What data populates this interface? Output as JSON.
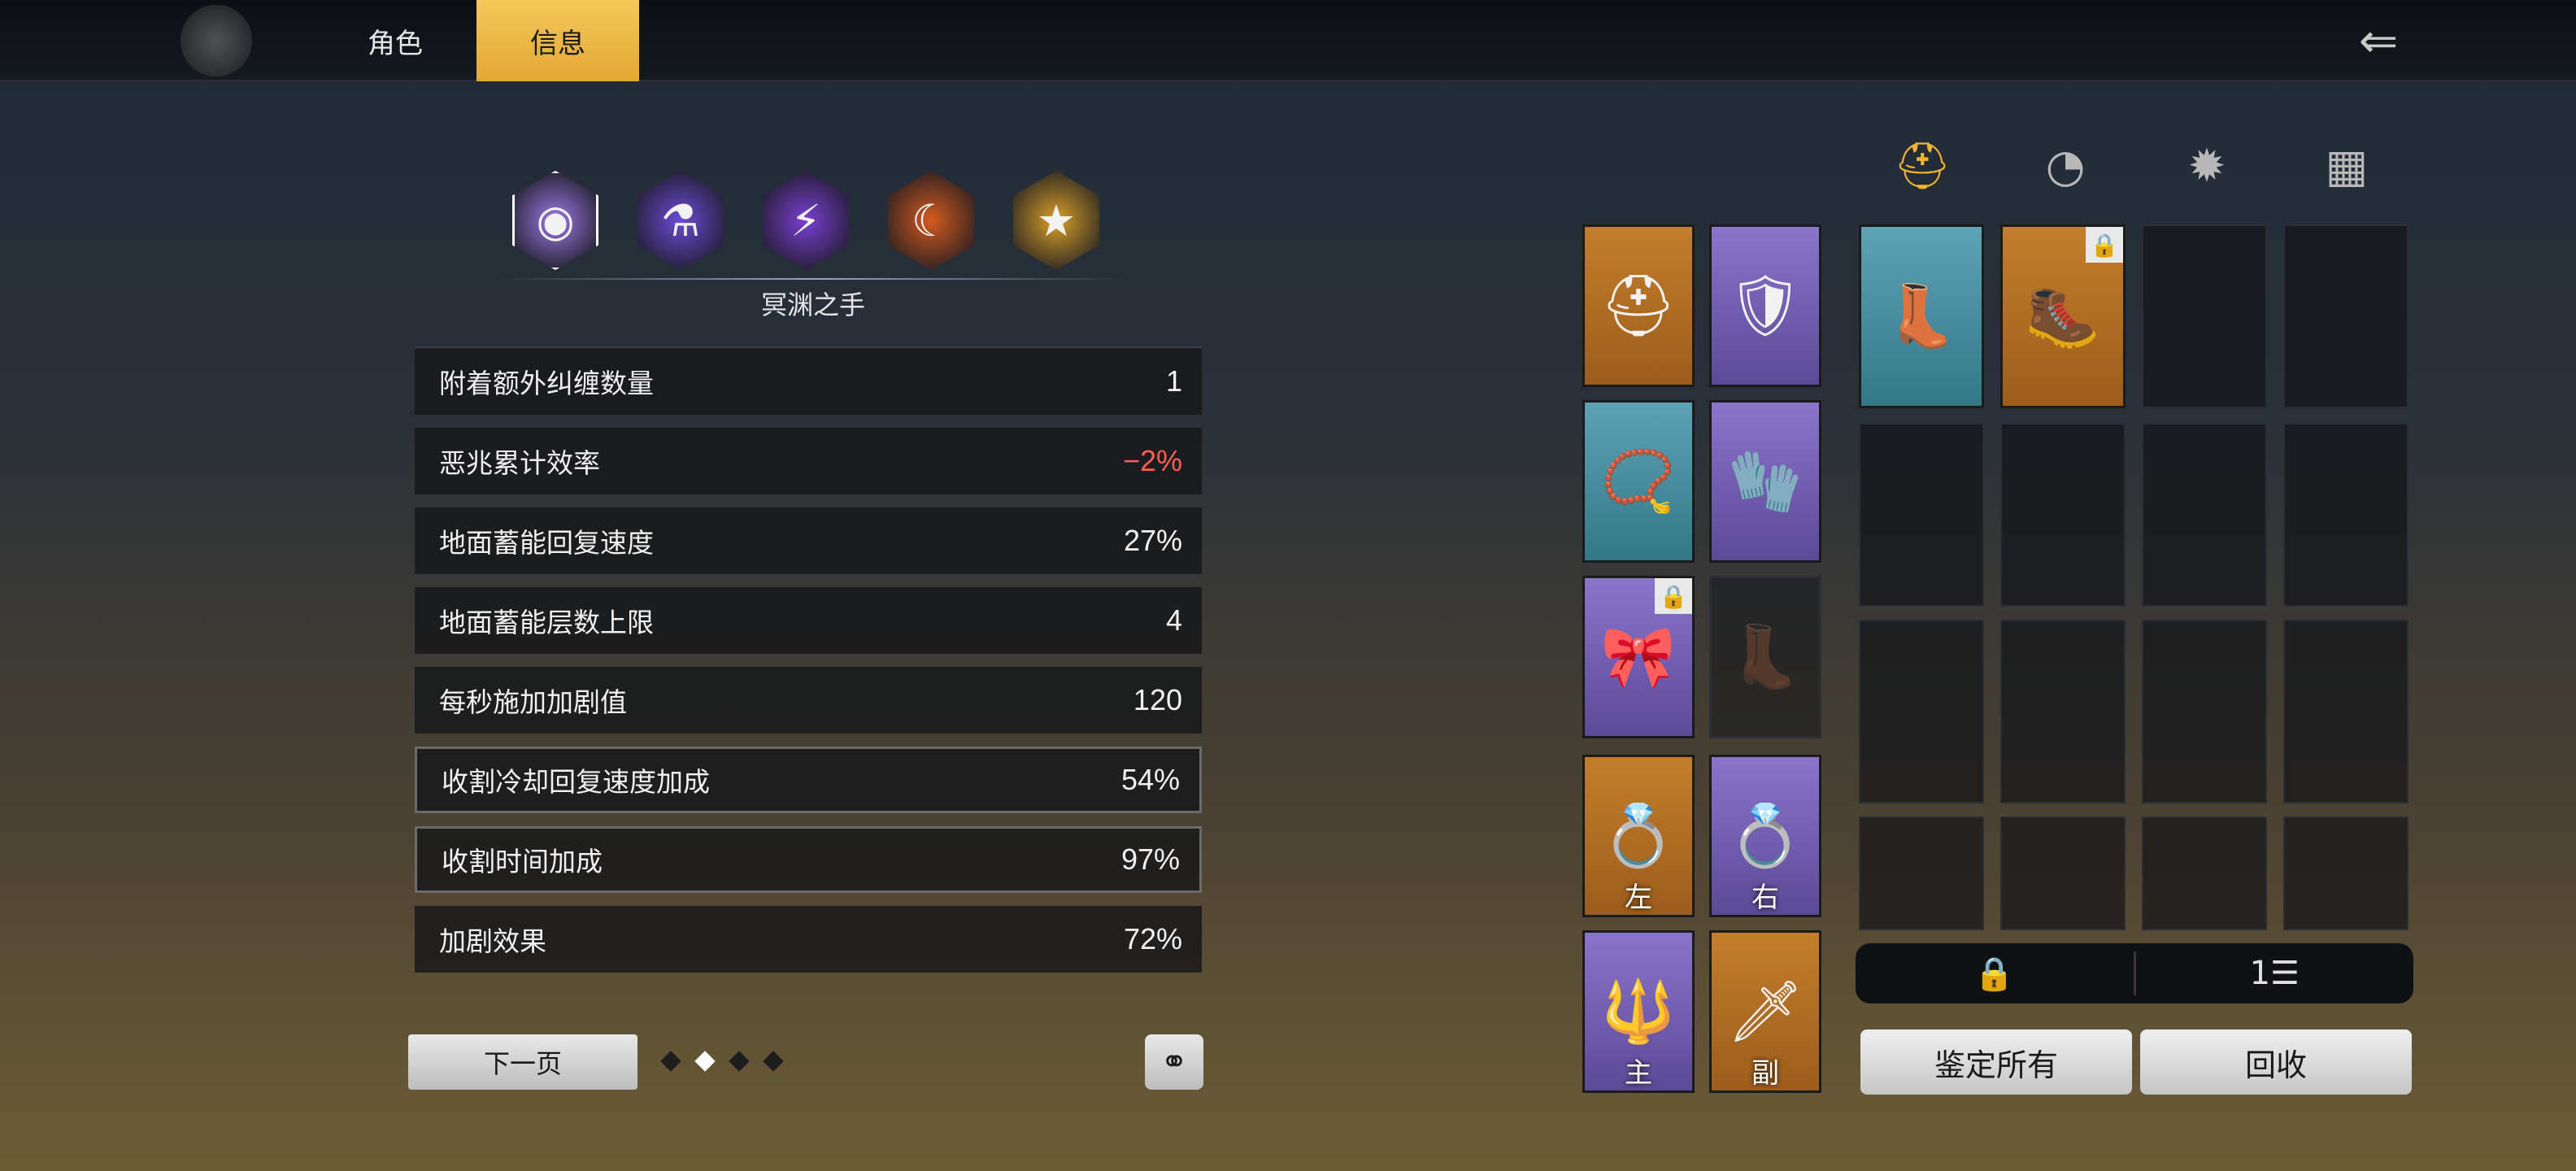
{
  "header": {
    "tabs": [
      {
        "label": "角色",
        "active": false
      },
      {
        "label": "信息",
        "active": true
      }
    ],
    "back_icon": "back-arrow-icon",
    "accent_color": "#f0b431"
  },
  "skills": {
    "icons": [
      {
        "name": "void-vortex-icon",
        "glyph": "◉",
        "color": "#9d7ae6"
      },
      {
        "name": "potion-orb-icon",
        "glyph": "⚗",
        "color": "#6b4bd6"
      },
      {
        "name": "purple-lightning-icon",
        "glyph": "⚡",
        "color": "#7a3fd2"
      },
      {
        "name": "fire-crescent-icon",
        "glyph": "☾",
        "color": "#d45a1f"
      },
      {
        "name": "gold-star-icon",
        "glyph": "★",
        "color": "#d9a028"
      }
    ],
    "selected_name": "冥渊之手"
  },
  "stats": [
    {
      "label": "附着额外纠缠数量",
      "value": "1",
      "negative": false,
      "highlight": false
    },
    {
      "label": "恶兆累计效率",
      "value": "−2%",
      "negative": true,
      "highlight": false
    },
    {
      "label": "地面蓄能回复速度",
      "value": "27%",
      "negative": false,
      "highlight": false
    },
    {
      "label": "地面蓄能层数上限",
      "value": "4",
      "negative": false,
      "highlight": false
    },
    {
      "label": "每秒施加加剧值",
      "value": "120",
      "negative": false,
      "highlight": false
    },
    {
      "label": "收割冷却回复速度加成",
      "value": "54%",
      "negative": false,
      "highlight": true
    },
    {
      "label": "收割时间加成",
      "value": "97%",
      "negative": false,
      "highlight": true
    },
    {
      "label": "加剧效果",
      "value": "72%",
      "negative": false,
      "highlight": false
    }
  ],
  "pagination": {
    "next_label": "下一页",
    "total_pages": 4,
    "current_page": 2,
    "share_icon": "share-icon"
  },
  "equipment": {
    "slots": [
      {
        "name": "helmet",
        "rarity": "orange",
        "glyph": "⛑",
        "label": "",
        "locked": false
      },
      {
        "name": "chest-armor",
        "rarity": "purple",
        "glyph": "🛡",
        "label": "",
        "locked": false
      },
      {
        "name": "necklace",
        "rarity": "teal",
        "glyph": "📿",
        "label": "",
        "locked": false
      },
      {
        "name": "gloves",
        "rarity": "purple",
        "glyph": "🧤",
        "label": "",
        "locked": false
      },
      {
        "name": "belt",
        "rarity": "purple",
        "glyph": "🎀",
        "label": "",
        "locked": true
      },
      {
        "name": "boots-empty",
        "rarity": "empty",
        "glyph": "👢",
        "label": "",
        "locked": false
      },
      {
        "name": "ring-left",
        "rarity": "orange",
        "glyph": "💍",
        "label": "左",
        "locked": false
      },
      {
        "name": "ring-right",
        "rarity": "purple",
        "glyph": "💍",
        "label": "右",
        "locked": false
      },
      {
        "name": "weapon-main",
        "rarity": "purple",
        "glyph": "🔱",
        "label": "主",
        "locked": false
      },
      {
        "name": "weapon-off",
        "rarity": "orange",
        "glyph": "🗡",
        "label": "副",
        "locked": false
      }
    ]
  },
  "inventory": {
    "category_tabs": [
      {
        "name": "helmet-category-icon",
        "glyph": "⛑",
        "active": true
      },
      {
        "name": "gear-category-icon",
        "glyph": "◔",
        "active": false
      },
      {
        "name": "skill-category-icon",
        "glyph": "✹",
        "active": false
      },
      {
        "name": "grid-category-icon",
        "glyph": "▦",
        "active": false
      }
    ],
    "items": [
      {
        "rarity": "teal",
        "glyph": "👢",
        "locked": false
      },
      {
        "rarity": "orange",
        "glyph": "🥾",
        "locked": true
      }
    ],
    "lock_icon": "🔒",
    "sort_icon": "1☰",
    "identify_all_label": "鉴定所有",
    "recycle_label": "回收"
  }
}
